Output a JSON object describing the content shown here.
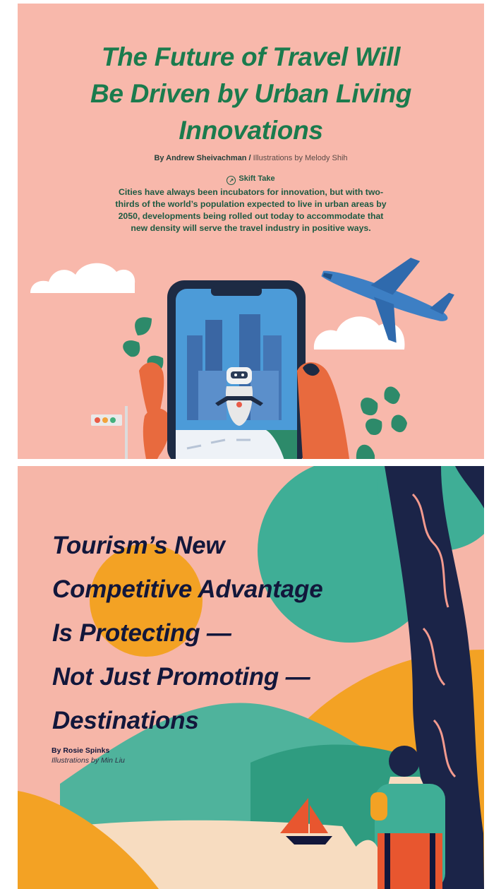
{
  "article1": {
    "title_lines": [
      "The Future of Travel Will",
      "Be Driven by Urban Living",
      "Innovations"
    ],
    "author": "By Andrew Sheivachman /",
    "illustrator": "Illustrations by Melody Shih",
    "skift_label": "Skift Take",
    "summary_lines": [
      "Cities have always been incubators for innovation, but with two-",
      "thirds of the world’s population expected to live in urban areas by",
      "2050, developments being rolled out today to accommodate that",
      "new density will serve the travel industry in positive ways."
    ]
  },
  "article2": {
    "title_lines": [
      "Tourism’s New",
      "Competitive Advantage",
      "Is Protecting —",
      "Not Just Promoting —",
      "Destinations"
    ],
    "author": "By Rosie Spinks",
    "illustrator": "Illustrations by Min Liu"
  },
  "colors": {
    "panel1_bg": "#f8b8ab",
    "panel1_title": "#1b7b4d",
    "panel2_bg": "#f6b6a8",
    "panel2_title": "#12173b"
  }
}
